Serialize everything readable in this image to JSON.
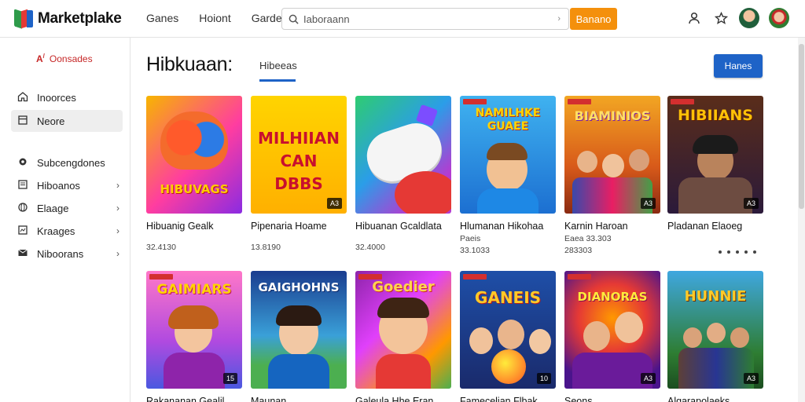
{
  "app": {
    "title": "Marketplake"
  },
  "topnav": [
    "Ganes",
    "Hoiont",
    "Garde"
  ],
  "search": {
    "value": "Iaboraann",
    "button": "Banano"
  },
  "sidebar": {
    "top_link": "Oonsades",
    "items": [
      {
        "label": "Inoorces",
        "icon": "home-icon",
        "arrow": false,
        "active": false
      },
      {
        "label": "Neore",
        "icon": "store-icon",
        "arrow": false,
        "active": true
      },
      {
        "label": "Subcengdones",
        "icon": "gear-icon",
        "arrow": false,
        "active": false
      },
      {
        "label": "Hiboanos",
        "icon": "list-icon",
        "arrow": true,
        "active": false
      },
      {
        "label": "Elaage",
        "icon": "globe-icon",
        "arrow": true,
        "active": false
      },
      {
        "label": "Kraages",
        "icon": "game-icon",
        "arrow": true,
        "active": false
      },
      {
        "label": "Niboorans",
        "icon": "mail-icon",
        "arrow": true,
        "active": false
      }
    ]
  },
  "main": {
    "title": "Hibkuaan:",
    "tab": "Hibeeas",
    "primary_button": "Hanes"
  },
  "products": [
    {
      "name": "Hibuanig Gealk",
      "sub": "",
      "price": "32.4130",
      "thumb_text": "HIBUVAGS",
      "badge": ""
    },
    {
      "name": "Pipenaria Hoame",
      "sub": "",
      "price": "13.8190",
      "thumb_text": "MILHIIAN CAN DBBS",
      "badge": "A3"
    },
    {
      "name": "Hibuanan Gcaldlata",
      "sub": "",
      "price": "32.4000",
      "thumb_text": "",
      "badge": ""
    },
    {
      "name": "Hlumanan Hikohaa",
      "sub": "Paeis",
      "price": "33.1033",
      "thumb_text": "NAMILHKE GUAEE",
      "badge": ""
    },
    {
      "name": "Karnin Haroan",
      "sub": "Eaea 33.303",
      "price": "283303",
      "thumb_text": "BIAMINIOS",
      "badge": "A3"
    },
    {
      "name": "Pladanan Elaoeg",
      "sub": "",
      "price": "",
      "thumb_text": "HIBIIANS",
      "badge": "A3"
    },
    {
      "name": "Rakananan Gealil",
      "sub": "",
      "price": "",
      "thumb_text": "GAIMIARS",
      "badge": "15"
    },
    {
      "name": "Maunan",
      "sub": "",
      "price": "",
      "thumb_text": "GAIGHOHNS",
      "badge": ""
    },
    {
      "name": "Galeula Hhe Eran",
      "sub": "",
      "price": "",
      "thumb_text": "Goedier",
      "badge": ""
    },
    {
      "name": "Famecelian Flbak",
      "sub": "",
      "price": "",
      "thumb_text": "GANEIS",
      "badge": "10"
    },
    {
      "name": "Seons",
      "sub": "",
      "price": "",
      "thumb_text": "DIANORAS",
      "badge": "A3"
    },
    {
      "name": "Algarapolaeks",
      "sub": "",
      "price": "",
      "thumb_text": "HUNNIE",
      "badge": "A3"
    }
  ],
  "colors": {
    "accent_orange": "#f4900c",
    "accent_blue": "#1e63c7",
    "side_red": "#c62828"
  }
}
